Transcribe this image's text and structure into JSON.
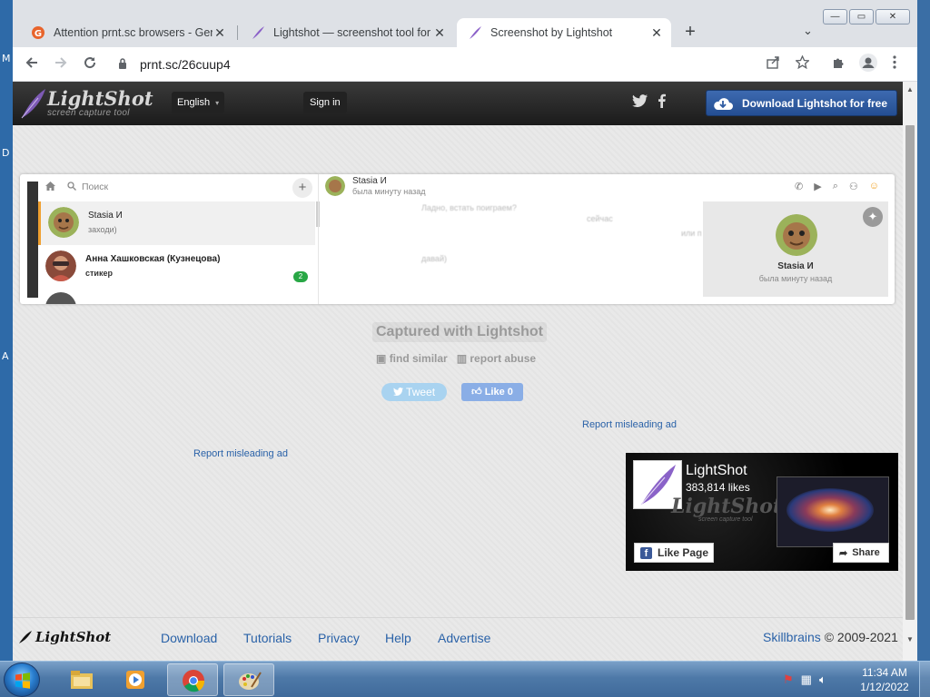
{
  "desktop": {
    "letters": [
      "M",
      "D",
      "A"
    ]
  },
  "window": {
    "minimize": "—",
    "maximize": "▭",
    "close": "✕"
  },
  "tabs": [
    {
      "title": "Attention prnt.sc browsers - Gen",
      "close": "✕"
    },
    {
      "title": "Lightshot — screenshot tool for M",
      "close": "✕"
    },
    {
      "title": "Screenshot by Lightshot",
      "close": "✕"
    }
  ],
  "newtab": "+",
  "tabsearch": "⌄",
  "toolbar": {
    "url": "prnt.sc/26cuup4"
  },
  "lightshot": {
    "logo_name": "LightShot",
    "logo_sub": "screen capture tool",
    "language": "English",
    "signin": "Sign in",
    "download": "Download Lightshot for free"
  },
  "screenshot": {
    "search_placeholder": "Поиск",
    "contacts": [
      {
        "name": "Stasia И",
        "message": "заходи)",
        "badge": ""
      },
      {
        "name": "Анна Хашковская (Кузнецова)",
        "message": "стикер",
        "badge": "2"
      }
    ],
    "chat_name": "Stasia И",
    "chat_status": "была минуту назад",
    "msg1": "Ладно, встать поиграем?",
    "msg2": "сейчас",
    "msg3": "или п",
    "msg4": "давай)",
    "profile_name": "Stasia И",
    "profile_status": "была минуту назад"
  },
  "captured": "Captured with Lightshot",
  "find_similar": "find similar",
  "report_abuse": "report abuse",
  "tweet": "Tweet",
  "like": "Like 0",
  "report_ad_1": "Report misleading ad",
  "report_ad_2": "Report misleading ad",
  "fb": {
    "title": "LightShot",
    "likes": "383,814 likes",
    "watermark": "LightShot",
    "watermark_sub": "screen capture tool",
    "like_page": "Like Page",
    "share": "Share"
  },
  "footer": {
    "logo": "LightShot",
    "links": [
      "Download",
      "Tutorials",
      "Privacy",
      "Help",
      "Advertise"
    ],
    "company": "Skillbrains",
    "copyright": "© 2009-2021"
  },
  "clock": {
    "time": "11:34 AM",
    "date": "1/12/2022"
  },
  "colors": {
    "accent": "#2a62a8",
    "header": "#1b1b1b",
    "download_button": "#2f5ca2"
  }
}
